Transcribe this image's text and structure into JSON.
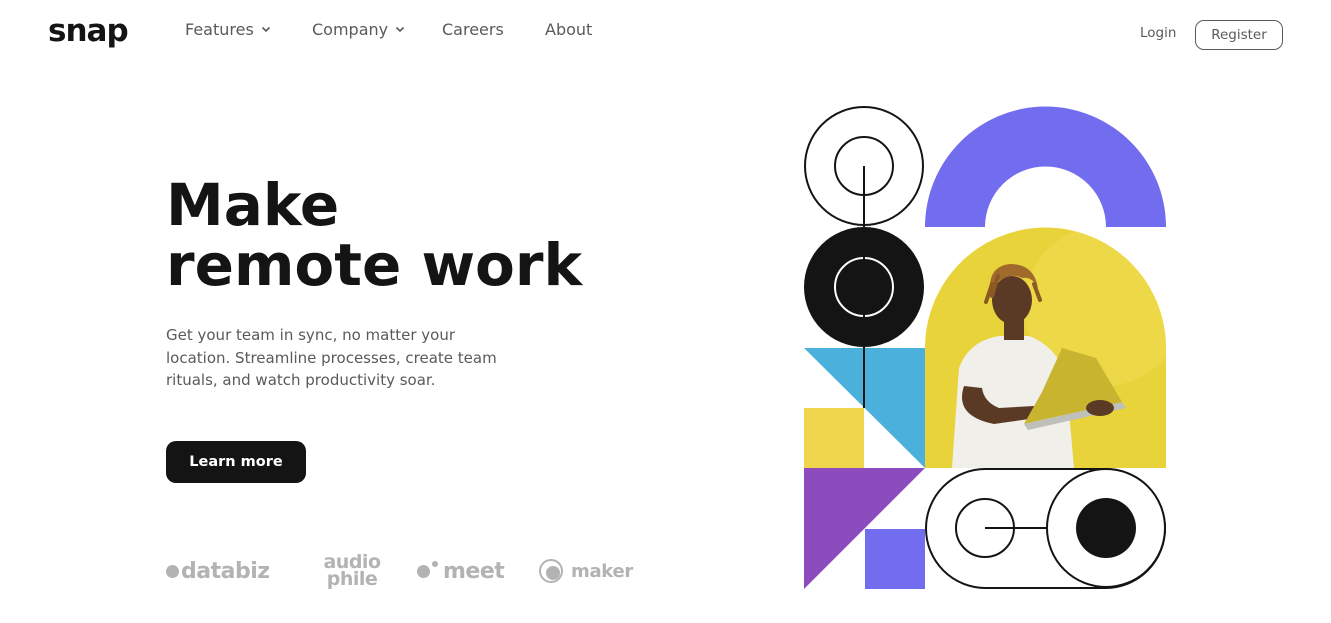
{
  "brand": {
    "logo_text": "snap"
  },
  "nav": {
    "items": [
      {
        "label": "Features",
        "has_dropdown": true,
        "icon": "chevron-down-icon"
      },
      {
        "label": "Company",
        "has_dropdown": true,
        "icon": "chevron-down-icon"
      },
      {
        "label": "Careers",
        "has_dropdown": false
      },
      {
        "label": "About",
        "has_dropdown": false
      }
    ],
    "login_label": "Login",
    "register_label": "Register"
  },
  "hero": {
    "headline_line1": "Make",
    "headline_line2": "remote work",
    "subtitle": "Get your team in sync, no matter your location. Streamline processes, create team rituals, and watch productivity soar.",
    "cta_label": "Learn more"
  },
  "clients": {
    "databiz": "databiz",
    "audiophile_line1": "audio",
    "audiophile_line2": "phile",
    "meet": "meet",
    "maker": "maker"
  },
  "colors": {
    "text_dark": "#141414",
    "text_gray": "#5a5a5a",
    "logo_gray": "#b3b3b3",
    "violet": "#726cee",
    "purple": "#8c4cbd",
    "sky_blue": "#4bb1dc",
    "mustard": "#efd64d",
    "photo_yellow": "#e8d33a"
  }
}
